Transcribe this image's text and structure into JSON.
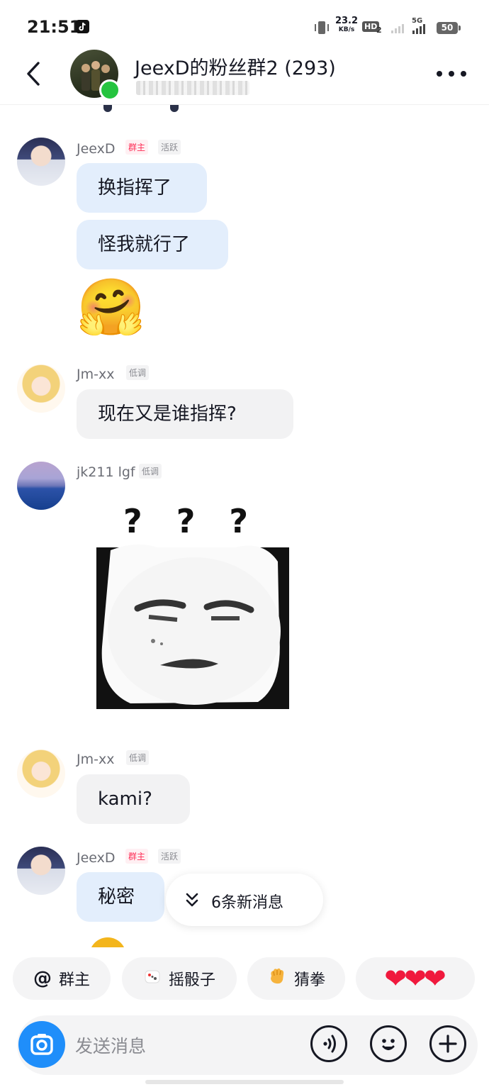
{
  "status_bar": {
    "time": "21:51",
    "net_speed": "23.2",
    "net_unit": "KB/s",
    "hd": "HD",
    "hd_sub": "2",
    "network": "5G",
    "battery": "50"
  },
  "header": {
    "title": "JeexD的粉丝群2 (293)"
  },
  "messages": [
    {
      "sender": "JeexD",
      "badges": [
        "群主",
        "活跃"
      ],
      "bubbles": [
        "换指挥了",
        "怪我就行了"
      ],
      "emoji": "🤗"
    },
    {
      "sender": "Jm-xx",
      "badges": [
        "低调"
      ],
      "bubbles": [
        "现在又是谁指挥?"
      ]
    },
    {
      "sender": "jk211 lgf",
      "badges": [
        "低调"
      ],
      "sticker_text": "? ? ?"
    },
    {
      "sender": "Jm-xx",
      "badges": [
        "低调"
      ],
      "bubbles": [
        "kami?"
      ]
    },
    {
      "sender": "JeexD",
      "badges": [
        "群主",
        "活跃"
      ],
      "bubbles": [
        "秘密"
      ]
    }
  ],
  "new_messages": "6条新消息",
  "quick_actions": [
    {
      "label": "群主",
      "icon": "@"
    },
    {
      "label": "摇骰子",
      "icon": "dice-icon"
    },
    {
      "label": "猜拳",
      "icon": "fist-icon"
    },
    {
      "label": "",
      "icon": "hearts-icon"
    }
  ],
  "input": {
    "placeholder": "发送消息"
  },
  "colors": {
    "accent_blue": "#1f8efa",
    "online_green": "#25c43f",
    "owner_tag": "#fe2c55",
    "bubble_self": "#e3eefc",
    "bubble_other": "#f2f2f3"
  }
}
